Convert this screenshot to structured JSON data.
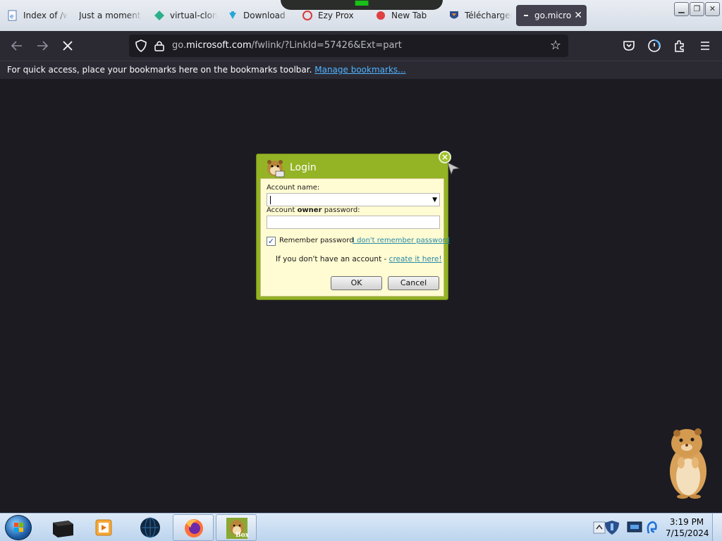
{
  "tabs": [
    {
      "title": "Index of /w",
      "icon": "ie-page-icon"
    },
    {
      "title": "Just a moment...",
      "icon": "blank-page-icon"
    },
    {
      "title": "virtual-clon",
      "icon": "green-diamond-icon"
    },
    {
      "title": "Download",
      "icon": "download-arrow-icon"
    },
    {
      "title": "Ezy Prox",
      "icon": "ezy-prox-icon"
    },
    {
      "title": "New Tab",
      "icon": "new-tab-icon"
    },
    {
      "title": "Télécharger",
      "icon": "fox-shield-icon"
    },
    {
      "title": "go.micro",
      "icon": "loading-icon",
      "active": true
    }
  ],
  "nav": {
    "url_prefix": "go.",
    "url_host": "microsoft.com",
    "url_path": "/fwlink/?LinkId=57426&Ext=part"
  },
  "bookmarks_bar": {
    "message": "For quick access, place your bookmarks here on the bookmarks toolbar.",
    "manage_link": "Manage bookmarks..."
  },
  "login_dialog": {
    "title": "Login",
    "account_label": "Account name:",
    "password_label_prefix": "Account ",
    "password_label_bold": "owner",
    "password_label_suffix": " password:",
    "account_value": "",
    "password_value": "",
    "remember_label": "Remember password",
    "remember_checked": true,
    "forgot_link": "I don't remember password",
    "no_account_text": "If you don't have an account - ",
    "create_link": "create it here!",
    "ok_label": "OK",
    "cancel_label": "Cancel",
    "theme_color": "#94b325",
    "body_color": "#fffbd2"
  },
  "taskbar": {
    "apps": [
      {
        "name": "black-box-app-icon",
        "open": false
      },
      {
        "name": "media-player-icon",
        "open": false
      },
      {
        "name": "dark-globe-icon",
        "open": false
      },
      {
        "name": "firefox-icon",
        "open": true
      },
      {
        "name": "hamster-box-icon",
        "open": true,
        "label": "Box"
      }
    ],
    "time": "3:19 PM",
    "date": "7/15/2024"
  }
}
